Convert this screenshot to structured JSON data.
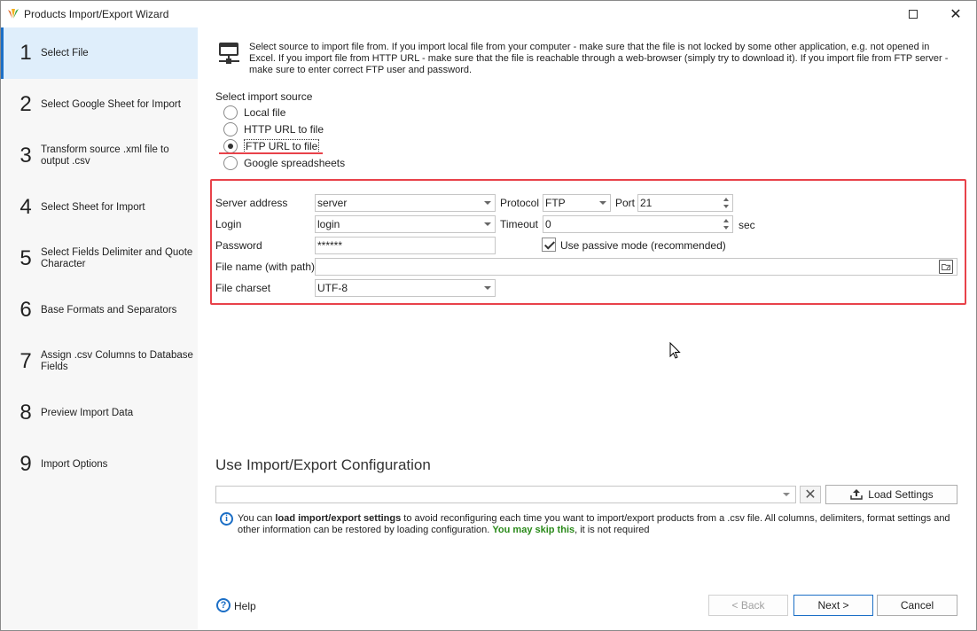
{
  "window": {
    "title": "Products Import/Export Wizard"
  },
  "steps": [
    {
      "num": "1",
      "label": "Select File",
      "active": true
    },
    {
      "num": "2",
      "label": "Select Google Sheet for Import"
    },
    {
      "num": "3",
      "label": "Transform source .xml file to output .csv"
    },
    {
      "num": "4",
      "label": "Select Sheet for Import"
    },
    {
      "num": "5",
      "label": "Select Fields Delimiter and Quote Character"
    },
    {
      "num": "6",
      "label": "Base Formats and Separators"
    },
    {
      "num": "7",
      "label": "Assign .csv Columns to Database Fields"
    },
    {
      "num": "8",
      "label": "Preview Import Data"
    },
    {
      "num": "9",
      "label": "Import Options"
    }
  ],
  "intro": "Select source to import file from. If you import local file from your computer - make sure that the file is not locked by some other application, e.g. not opened in Excel. If you import file from HTTP URL - make sure that the file is reachable through a web-browser (simply try to download it). If you import file from FTP server - make sure to enter correct FTP user and password.",
  "source": {
    "label": "Select import source",
    "options": [
      "Local file",
      "HTTP URL to file",
      "FTP URL to file",
      "Google spreadsheets"
    ],
    "selected": "FTP URL to file"
  },
  "ftp": {
    "server_label": "Server address",
    "server_value": "server",
    "protocol_label": "Protocol",
    "protocol_value": "FTP",
    "port_label": "Port",
    "port_value": "21",
    "login_label": "Login",
    "login_value": "login",
    "timeout_label": "Timeout",
    "timeout_value": "0",
    "timeout_unit": "sec",
    "password_label": "Password",
    "password_value": "******",
    "passive_label": "Use passive mode (recommended)",
    "passive_checked": true,
    "filename_label": "File name (with path)",
    "filename_value": "",
    "charset_label": "File charset",
    "charset_value": "UTF-8"
  },
  "config": {
    "title": "Use Import/Export Configuration",
    "value": "",
    "load_label": "Load Settings",
    "hint_pre": "You can ",
    "hint_bold": "load import/export settings",
    "hint_mid": " to avoid reconfiguring each time you want to import/export products from a .csv file. All columns, delimiters, format settings and other information can be restored by loading configuration. ",
    "hint_green": "You may skip this",
    "hint_post": ", it is not required"
  },
  "footer": {
    "help": "Help",
    "back": "< Back",
    "next": "Next >",
    "cancel": "Cancel"
  },
  "colors": {
    "accent": "#1c6fc6",
    "highlight_box": "#e8424a",
    "skip_green": "#2a8a1a",
    "active_step_bg": "#dfeefb"
  }
}
